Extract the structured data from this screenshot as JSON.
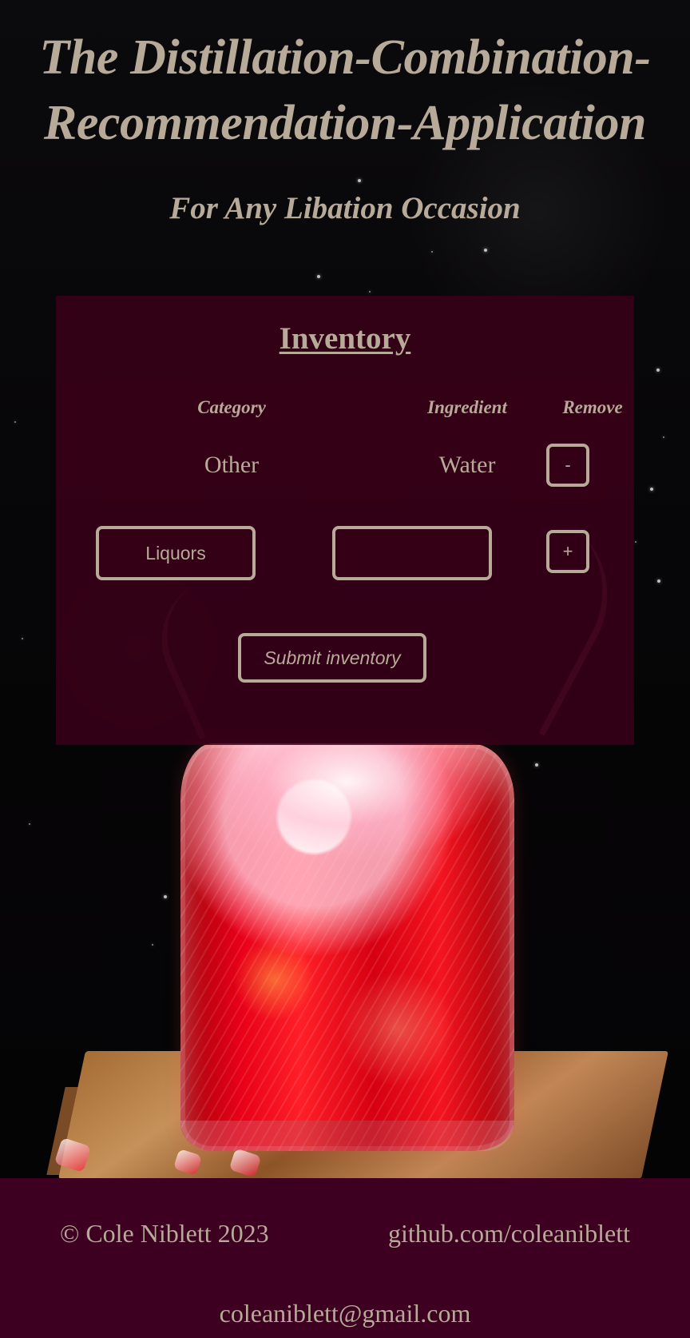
{
  "header": {
    "title_line_1": "The Distillation-Combination-",
    "title_line_2": "Recommendation-Application",
    "subtitle": "For Any Libation Occasion"
  },
  "inventory": {
    "title": "Inventory",
    "columns": {
      "category": "Category",
      "ingredient": "Ingredient",
      "remove": "Remove"
    },
    "items": [
      {
        "category": "Other",
        "ingredient": "Water",
        "remove_label": "-"
      }
    ],
    "new_item": {
      "category_value": "Liquors",
      "ingredient_value": "",
      "ingredient_placeholder": "",
      "add_label": "+"
    },
    "submit_label": "Submit inventory"
  },
  "footer": {
    "copyright": "© Cole Niblett 2023",
    "github": "github.com/coleaniblett",
    "email": "coleaniblett@gmail.com"
  },
  "colors": {
    "text": "#b8aa98",
    "panel": "#3d0020",
    "background": "#050406"
  }
}
